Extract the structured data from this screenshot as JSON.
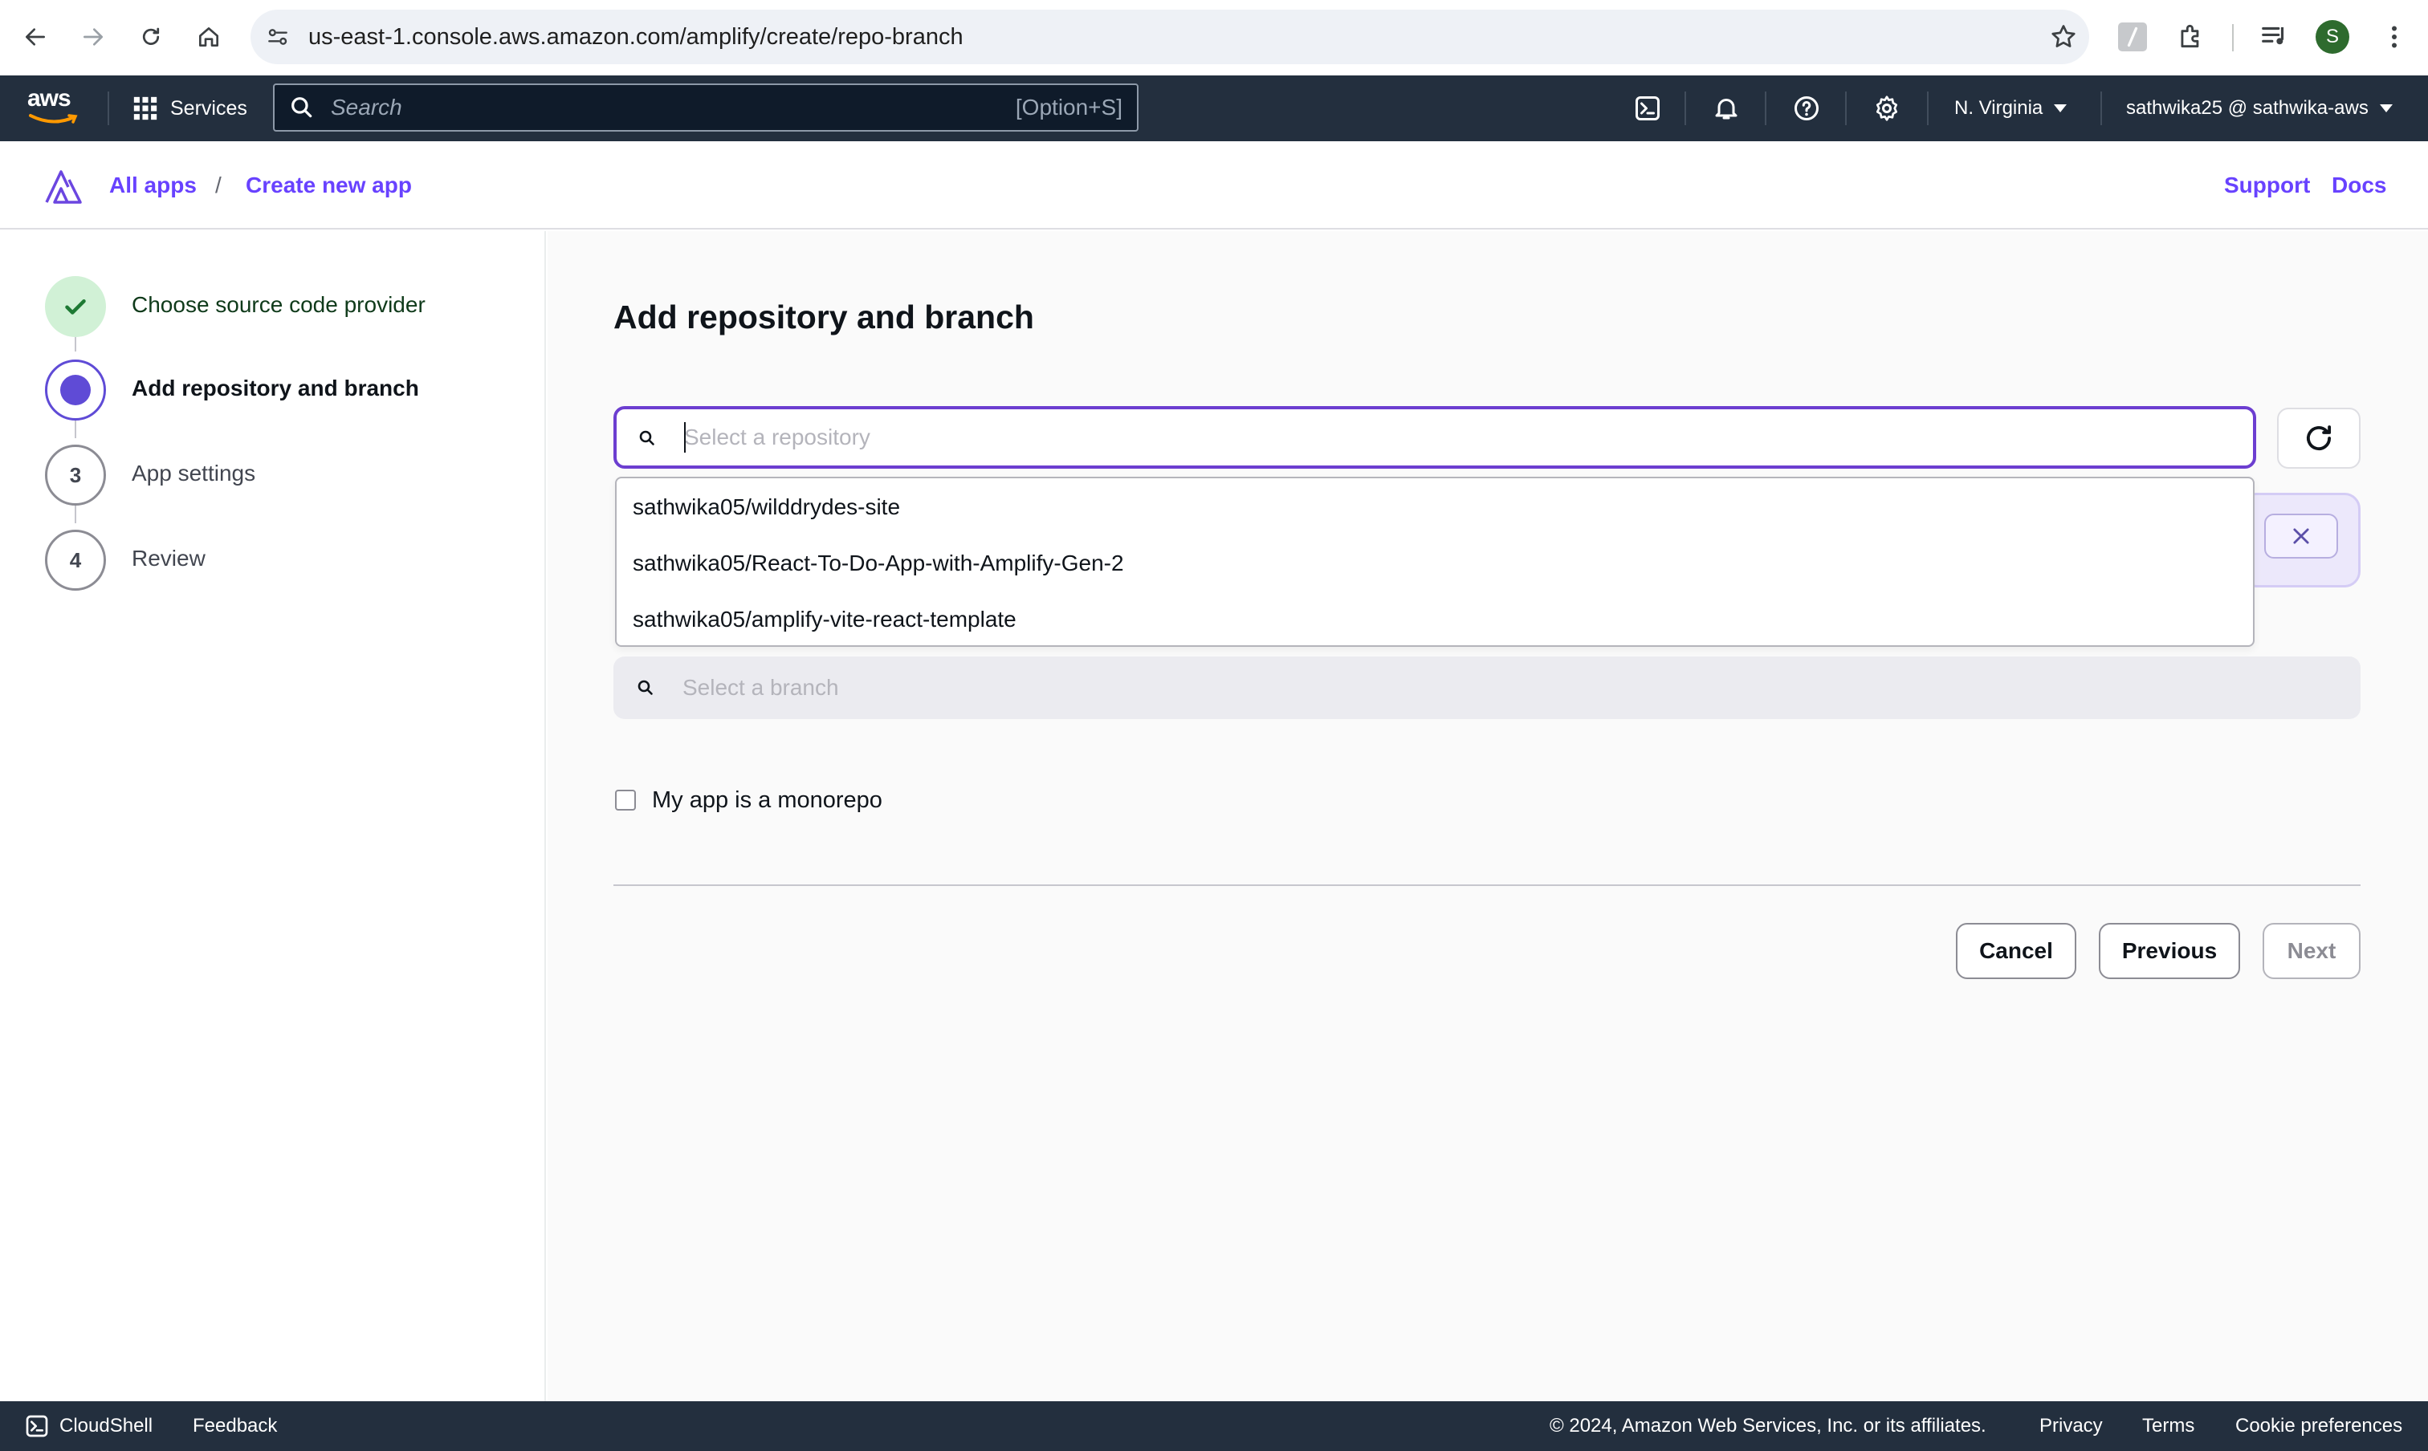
{
  "browser": {
    "url": "us-east-1.console.aws.amazon.com/amplify/create/repo-branch",
    "avatar_initial": "S"
  },
  "aws_nav": {
    "logo": "aws",
    "services_label": "Services",
    "search_placeholder": "Search",
    "search_shortcut": "[Option+S]",
    "region": "N. Virginia",
    "account": "sathwika25 @ sathwika-aws"
  },
  "breadcrumb": {
    "items": [
      "All apps",
      "Create new app"
    ],
    "separator": "/",
    "support": "Support",
    "docs": "Docs"
  },
  "steps": [
    {
      "number": "",
      "label": "Choose source code provider",
      "state": "completed"
    },
    {
      "number": "",
      "label": "Add repository and branch",
      "state": "current"
    },
    {
      "number": "3",
      "label": "App settings",
      "state": "pending"
    },
    {
      "number": "4",
      "label": "Review",
      "state": "pending"
    }
  ],
  "main": {
    "title": "Add repository and branch",
    "repo_placeholder": "Select a repository",
    "repo_value": "",
    "repo_options": [
      "sathwika05/wilddrydes-site",
      "sathwika05/React-To-Do-App-with-Amplify-Gen-2",
      "sathwika05/amplify-vite-react-template"
    ],
    "branch_placeholder": "Select a branch",
    "monorepo_label": "My app is a monorepo",
    "monorepo_checked": false,
    "buttons": {
      "cancel": "Cancel",
      "previous": "Previous",
      "next": "Next"
    }
  },
  "footer": {
    "cloudshell": "CloudShell",
    "feedback": "Feedback",
    "copyright": "© 2024, Amazon Web Services, Inc. or its affiliates.",
    "privacy": "Privacy",
    "terms": "Terms",
    "cookies": "Cookie preferences"
  },
  "colors": {
    "accent": "#6842ff",
    "focus_border": "#6c3ed0",
    "aws_nav_bg": "#232f3e",
    "completed_step_bg": "#d1f1d6",
    "completed_check": "#1e7a34"
  }
}
